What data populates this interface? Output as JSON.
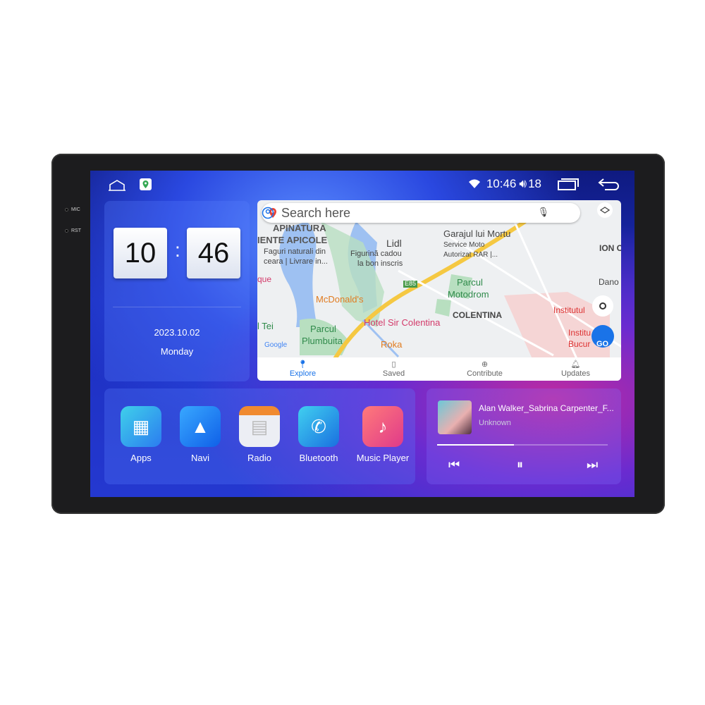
{
  "device": {
    "side_labels": [
      "MIC",
      "RST"
    ]
  },
  "status": {
    "time": "10:46",
    "volume": "18"
  },
  "clock": {
    "hours": "10",
    "minutes": "46",
    "separator": ":",
    "date": "2023.10.02",
    "weekday": "Monday"
  },
  "map": {
    "search_placeholder": "Search here",
    "labels": [
      "APINATURA",
      "IENTE APICOLE",
      "Faguri naturali din",
      "ceara | Livrare in...",
      "Lidl",
      "Figurină cadou",
      "la bon inscris",
      "Garajul lui Mortu",
      "Service Moto",
      "Autorizat RAR |...",
      "ION C",
      "que",
      "Dano",
      "McDonald's",
      "Parcul",
      "Motodrom",
      "COLENTINA",
      "Institutul",
      "l Tei",
      "Parcul",
      "Plumbuita",
      "Hotel Sir Colentina",
      "Roka",
      "Institu",
      "Bucur",
      "E85",
      "Google",
      "GO"
    ],
    "nav": [
      {
        "label": "Explore",
        "icon": "pin-icon"
      },
      {
        "label": "Saved",
        "icon": "bookmark-icon"
      },
      {
        "label": "Contribute",
        "icon": "plus-circle-icon"
      },
      {
        "label": "Updates",
        "icon": "bell-icon"
      }
    ]
  },
  "apps": [
    {
      "label": "Apps",
      "color": "#2ec4e0"
    },
    {
      "label": "Navi",
      "color": "#1e90ff"
    },
    {
      "label": "Radio",
      "color": "#e8e8ee"
    },
    {
      "label": "Bluetooth",
      "color": "#20b0e8"
    },
    {
      "label": "Music Player",
      "color": "#f0506e"
    }
  ],
  "music": {
    "title": "Alan Walker_Sabrina Carpenter_F...",
    "artist": "Unknown",
    "progress": 0.45
  }
}
